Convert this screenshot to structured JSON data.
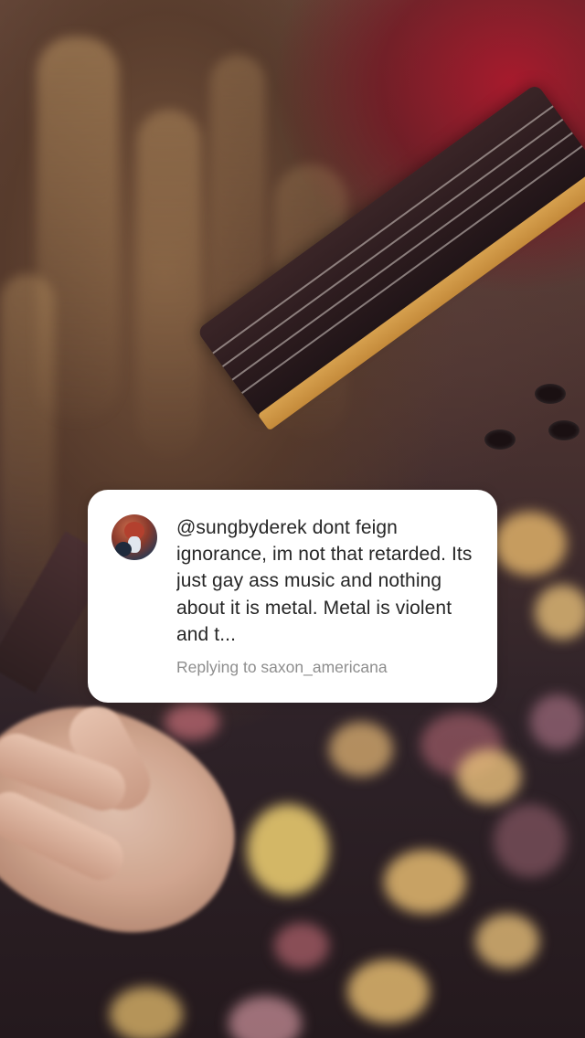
{
  "story": {
    "background": {
      "description_icon": "photo-background",
      "accent_colors": {
        "red": "#aa182c",
        "hair": "#7a5640",
        "wood": "#c48a3a",
        "dark": "#24191d"
      }
    },
    "comment_card": {
      "avatar_icon": "user-avatar",
      "text": "@sungbyderek dont feign ignorance, im not that retarded. Its just gay ass music and nothing about it is metal. Metal is violent and t...",
      "reply_prefix": "Replying to",
      "reply_username": "saxon_americana",
      "reply_line": "Replying to saxon_americana",
      "card_color": "#ffffff",
      "text_color": "#262626",
      "secondary_text_color": "#8e8e8e"
    }
  }
}
